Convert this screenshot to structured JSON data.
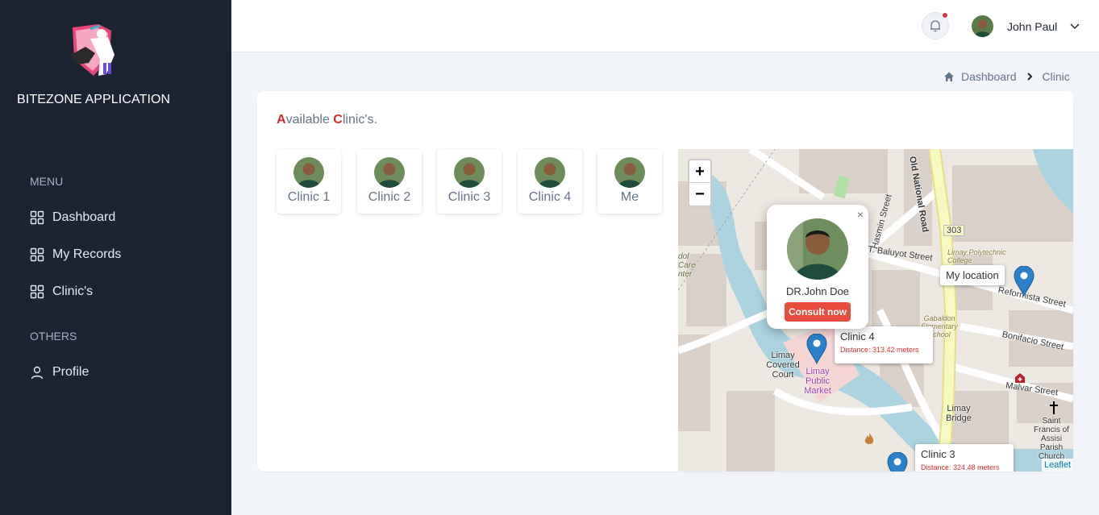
{
  "app": {
    "brand": "BITEZONE APPLICATION"
  },
  "sidebar": {
    "menu_label": "MENU",
    "items": [
      {
        "label": "Dashboard",
        "icon": "grid-icon"
      },
      {
        "label": "My Records",
        "icon": "grid-icon"
      },
      {
        "label": "Clinic's",
        "icon": "grid-icon"
      }
    ],
    "others_label": "OTHERS",
    "profile": {
      "label": "Profile",
      "icon": "user-icon"
    }
  },
  "header": {
    "user_name": "John Paul",
    "notification_dot_color": "#dc3545"
  },
  "breadcrumb": {
    "home": "Dashboard",
    "current": "Clinic"
  },
  "page": {
    "title_first_letter": "A",
    "title_rest": "vailable ",
    "title_second_letter": "C",
    "title_end": "linic's."
  },
  "clinics": [
    {
      "label": "Clinic 1"
    },
    {
      "label": "Clinic 2"
    },
    {
      "label": "Clinic 3"
    },
    {
      "label": "Clinic 4"
    },
    {
      "label": "Me"
    }
  ],
  "map": {
    "zoom_in": "+",
    "zoom_out": "−",
    "attribution": "Leaflet",
    "popup": {
      "close": "×",
      "name": "DR.John Doe",
      "button": "Consult now"
    },
    "my_location": "My location",
    "tooltips": [
      {
        "title": "Clinic 4",
        "distance": "Distance: 313.42 meters"
      },
      {
        "title": "Clinic 3",
        "distance": "Distance: 324.48 meters"
      }
    ],
    "labels": {
      "road": "Old National Road",
      "route": "303",
      "hasmin": "Hasmin Street",
      "baluyot": "T. Baluyot Street",
      "reformista": "Reformista Street",
      "bonifacio": "Bonifacio Street",
      "malvar": "Malvar Street",
      "covered_court": "Limay Covered Court",
      "market": "Limay Public Market",
      "bridge": "Limay Bridge",
      "church": "Saint Francis of Assisi Parish Church",
      "polytechnic": "Limay Polytechnic College",
      "gabaldon": "Gabaldon Elementary School",
      "care": "dol Care nter"
    },
    "colors": {
      "marker": "#2a81cb",
      "water": "#aad3df",
      "road_yellow": "#f7fabf"
    }
  }
}
